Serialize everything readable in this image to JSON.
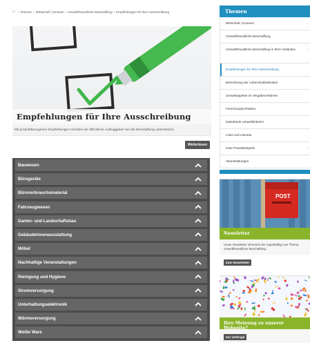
{
  "breadcrumb": {
    "items": [
      "Themen",
      "Wirtschaft | Konsum",
      "Umweltfreundliche Beschaffung",
      "Empfehlungen für Ihre Ausschreibung"
    ]
  },
  "hero": {
    "title": "Empfehlungen für Ihre Ausschreibung",
    "text": "Mit produktbezogenen Empfehlungen möchten wir öffentliche Auftraggeber bei der Beschaffung unterstützen.",
    "more_label": "Weiterlesen"
  },
  "accordion": {
    "items": [
      "Bauwesen",
      "Bürogeräte",
      "Büroverbrauchsmaterial",
      "Fahrzeugwesen",
      "Garten- und Landschaftsbau",
      "Gebäudeinnenausstattung",
      "Möbel",
      "Nachhaltige Veranstaltungen",
      "Reinigung und Hygiene",
      "Stromversorgung",
      "Unterhaltungselektronik",
      "Wärmeversorgung",
      "Weiße Ware"
    ]
  },
  "sidebar": {
    "title": "Themen",
    "items": [
      "Wirtschaft | Konsum",
      "Umweltfreundliche Beschaffung",
      "Umweltfreundliche Beschaffung in Ihrer Institution",
      "Empfehlungen für Ihre Ausschreibung",
      "Berechnung der Lebenszykluskosten",
      "Umweltaspekte im Vergabeverfahren",
      "Forschungsvorhaben",
      "Datenbank Umweltkriterien",
      "Links und Literatur",
      "Gute Praxisbeispiele",
      "Veranstaltungen"
    ],
    "active_index": 3
  },
  "newsletter": {
    "title": "Newsletter",
    "text": "Unser Newsletter informiert Sie regelmäßig zum Thema umweltfreundliche Beschaffung.",
    "button": "Zum Newsletter",
    "mailbox_label": "POST"
  },
  "survey": {
    "title": "Ihre Meinung zu unserer Webseite?",
    "button": "Zur Umfrage"
  },
  "colors": {
    "accent_blue": "#1e8fbf",
    "accent_green": "#8ab52a",
    "accordion_bg": "#4c4c4c",
    "accordion_item": "#666666"
  }
}
